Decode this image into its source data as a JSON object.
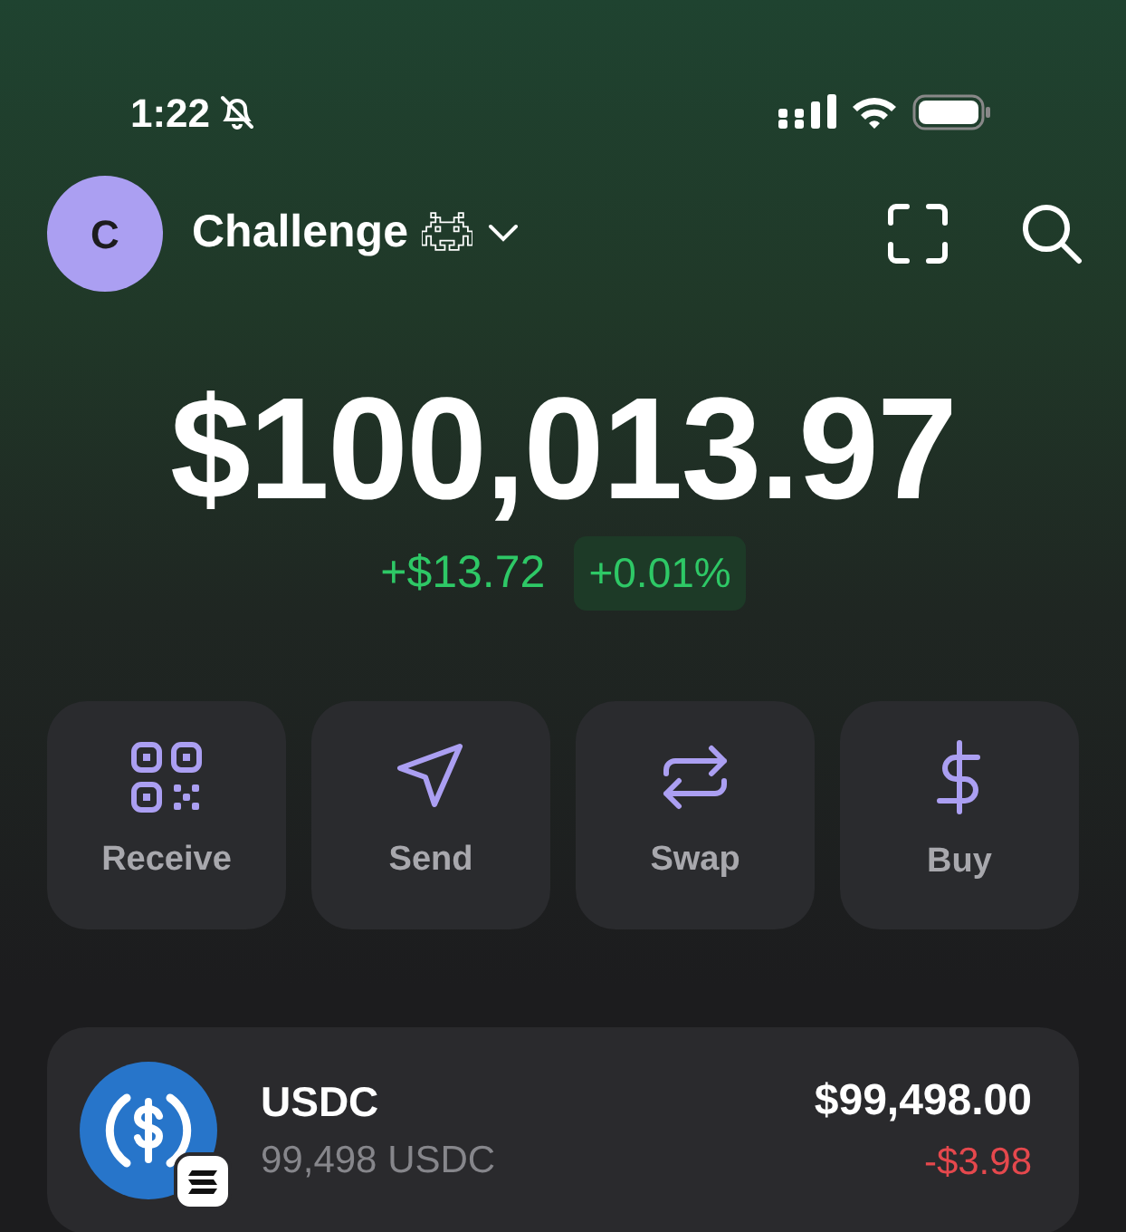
{
  "status_bar": {
    "time": "1:22",
    "silent": true
  },
  "header": {
    "avatar_letter": "C",
    "account_name": "Challenge"
  },
  "balance": {
    "total": "$100,013.97",
    "change": "+$13.72",
    "change_percent": "+0.01%",
    "positive": true
  },
  "actions": [
    {
      "label": "Receive",
      "kind": "receive"
    },
    {
      "label": "Send",
      "kind": "send"
    },
    {
      "label": "Swap",
      "kind": "swap"
    },
    {
      "label": "Buy",
      "kind": "buy"
    }
  ],
  "tokens": [
    {
      "name": "USDC",
      "amount": "99,498 USDC",
      "value": "$99,498.00",
      "change": "-$3.98",
      "positive": false
    }
  ]
}
